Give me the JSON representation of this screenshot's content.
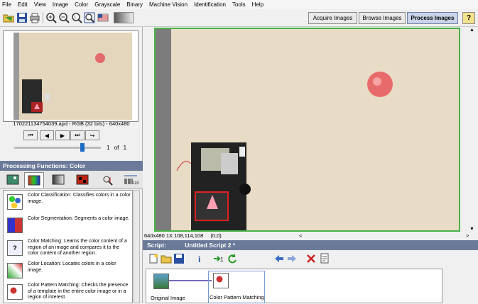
{
  "menu": [
    "File",
    "Edit",
    "View",
    "Image",
    "Color",
    "Grayscale",
    "Binary",
    "Machine Vision",
    "Identification",
    "Tools",
    "Help"
  ],
  "toolbar": {
    "modes": [
      {
        "label": "Acquire Images",
        "active": false
      },
      {
        "label": "Browse Images",
        "active": false
      },
      {
        "label": "Process Images",
        "active": true
      }
    ],
    "help_label": "?"
  },
  "thumbnail": {
    "filename": "170221134754039.apd - RGB (32 bits) - 640x480",
    "page_current": "1",
    "page_of": "of",
    "page_total": "1"
  },
  "processing": {
    "header": "Processing Functions: Color",
    "items": [
      {
        "title": "Color Classification:",
        "desc": "Classifies colors in a color image."
      },
      {
        "title": "Color Segmentation:",
        "desc": "Segments a color image."
      },
      {
        "title": "Color Matching:",
        "desc": "Learns the color content of a region of an image and compares it to the color content of another region."
      },
      {
        "title": "Color Location:",
        "desc": "Locates colors in a color image."
      },
      {
        "title": "Color Pattern Matching:",
        "desc": "Checks the presence of a template in the entire color image or in a region of interest."
      }
    ]
  },
  "status": {
    "info": "640x480 1X 108,114,108",
    "coords": "(0,0)"
  },
  "script": {
    "label": "Script:",
    "name": "Untitled Script 2 *",
    "steps": [
      "Original Image",
      "Color Pattern Matching"
    ]
  },
  "colors": {
    "header_bg": "#6b7a99",
    "active_frame": "#47b447",
    "slider": "#1d6bc4"
  }
}
